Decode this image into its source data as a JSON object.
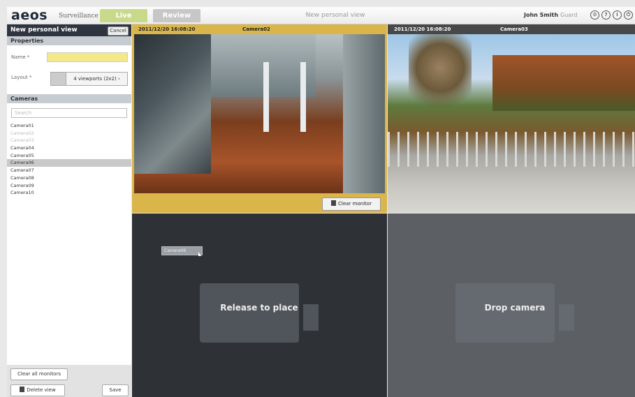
{
  "header": {
    "logo": "aeos",
    "logo_sub": "Surveillance",
    "tabs": [
      {
        "label": "Live",
        "active": true
      },
      {
        "label": "Review",
        "active": false
      }
    ],
    "center_title": "New personal view",
    "user_name": "John Smith",
    "user_role": "Guard",
    "icons": [
      "settings-icon",
      "help-icon",
      "info-icon",
      "logout-icon"
    ]
  },
  "sidebar": {
    "title": "New personal view",
    "cancel_label": "Cancel",
    "properties_label": "Properties",
    "name_label": "Name *",
    "name_value": "",
    "layout_label": "Layout *",
    "layout_value": "4 viewports (2x2) ›",
    "cameras_label": "Cameras",
    "search_placeholder": "Search",
    "cameras": [
      {
        "label": "Camera01",
        "state": "normal"
      },
      {
        "label": "Camera02",
        "state": "dim"
      },
      {
        "label": "Camera03",
        "state": "dim"
      },
      {
        "label": "Camera04",
        "state": "normal"
      },
      {
        "label": "Camera05",
        "state": "normal"
      },
      {
        "label": "Camera06",
        "state": "selected"
      },
      {
        "label": "Camera07",
        "state": "normal"
      },
      {
        "label": "Camera08",
        "state": "normal"
      },
      {
        "label": "Camera09",
        "state": "normal"
      },
      {
        "label": "Camera10",
        "state": "normal"
      }
    ],
    "clear_all_label": "Clear all monitors",
    "delete_label": "Delete view",
    "save_label": "Save"
  },
  "viewports": {
    "vp1": {
      "timestamp": "2011/12/20 16:08:20",
      "camera": "Camera02",
      "clear_label": "Clear monitor"
    },
    "vp2": {
      "timestamp": "2011/12/20 16:08:20",
      "camera": "Camera03"
    },
    "vp3": {
      "message": "Release to place",
      "drag_label": "Camera06"
    },
    "vp4": {
      "message": "Drop camera"
    }
  },
  "colors": {
    "accent": "#d9b54a",
    "live_tab": "#c9d98a",
    "header_dark": "#2f3540"
  }
}
